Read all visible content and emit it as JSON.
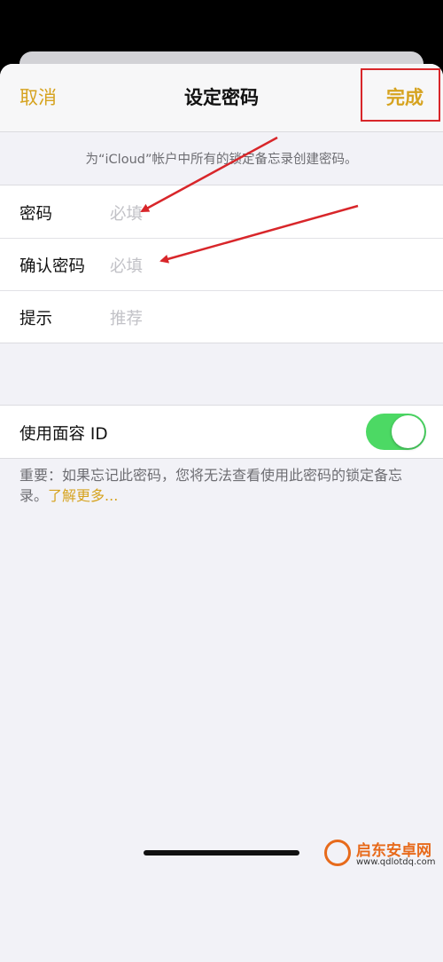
{
  "navbar": {
    "cancel": "取消",
    "title": "设定密码",
    "done": "完成"
  },
  "subtitle": "为“iCloud”帐户中所有的锁定备忘录创建密码。",
  "form": {
    "rows": [
      {
        "label": "密码",
        "placeholder": "必填"
      },
      {
        "label": "确认密码",
        "placeholder": "必填"
      },
      {
        "label": "提示",
        "placeholder": "推荐"
      }
    ]
  },
  "face_id": {
    "label": "使用面容 ID",
    "enabled": true
  },
  "note": {
    "text": "重要：如果忘记此密码，您将无法查看使用此密码的锁定备忘录。",
    "link": "了解更多..."
  },
  "watermark": {
    "name": "启东安卓网",
    "url": "www.qdlotdq.com"
  },
  "colors": {
    "accent": "#d6a31f",
    "toggle_on": "#4cd964",
    "annotation": "#d8262a"
  }
}
